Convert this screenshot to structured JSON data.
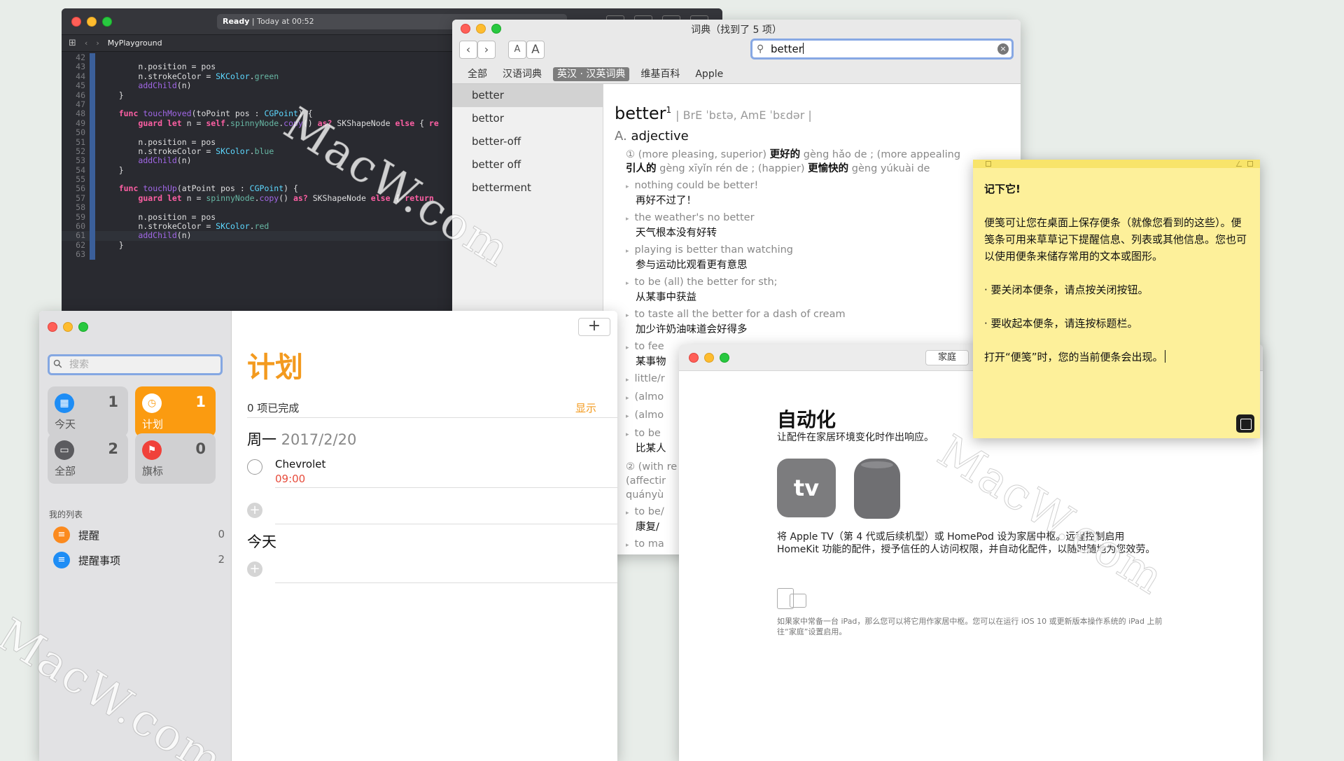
{
  "xcode": {
    "status_ready": "Ready",
    "status_time": " | Today at 00:52",
    "file": "MyPlayground",
    "lines": [
      {
        "n": "42",
        "html": ""
      },
      {
        "n": "43",
        "html": "        n.position = pos"
      },
      {
        "n": "44",
        "html": "        n.strokeColor = <span class='ty'>SKColor</span>.<span class='pr'>green</span>"
      },
      {
        "n": "45",
        "html": "        <span class='fn'>addChild</span>(n)"
      },
      {
        "n": "46",
        "html": "    }"
      },
      {
        "n": "47",
        "html": ""
      },
      {
        "n": "48",
        "html": "    <span class='kw'>func</span> <span class='fn'>touchMoved</span>(toPoint pos : <span class='ty'>CGPoint</span>) {"
      },
      {
        "n": "49",
        "html": "        <span class='kw'>guard let</span> n = <span class='kw'>self</span>.<span class='pr'>spinnyNode</span>.<span class='fn'>copy</span>() <span class='kw'>as?</span> SKShapeNode <span class='kw'>else</span> { <span class='kw'>re</span>"
      },
      {
        "n": "50",
        "html": ""
      },
      {
        "n": "51",
        "html": "        n.position = pos"
      },
      {
        "n": "52",
        "html": "        n.strokeColor = <span class='ty'>SKColor</span>.<span class='pr'>blue</span>"
      },
      {
        "n": "53",
        "html": "        <span class='fn'>addChild</span>(n)"
      },
      {
        "n": "54",
        "html": "    }"
      },
      {
        "n": "55",
        "html": ""
      },
      {
        "n": "56",
        "html": "    <span class='kw'>func</span> <span class='fn'>touchUp</span>(atPoint pos : <span class='ty'>CGPoint</span>) {"
      },
      {
        "n": "57",
        "html": "        <span class='kw'>guard let</span> n = <span class='pr'>spinnyNode</span>.<span class='fn'>copy</span>() <span class='kw'>as?</span> SKShapeNode <span class='kw'>else</span> { <span class='kw'>return</span>"
      },
      {
        "n": "58",
        "html": ""
      },
      {
        "n": "59",
        "html": "        n.position = pos"
      },
      {
        "n": "60",
        "html": "        n.strokeColor = <span class='ty'>SKColor</span>.<span class='pr'>red</span>"
      },
      {
        "n": "61",
        "html": "        <span class='fn'>addChild</span>(n)"
      },
      {
        "n": "62",
        "html": "    }"
      },
      {
        "n": "63",
        "html": ""
      }
    ]
  },
  "dict": {
    "window_title": "词典（找到了 5 项）",
    "back": "‹",
    "forward": "›",
    "font_small": "A",
    "font_big": "A",
    "search_value": "better",
    "tabs": [
      "全部",
      "汉语词典",
      "英汉 · 汉英词典",
      "维基百科",
      "Apple"
    ],
    "selected_tab": 2,
    "results": [
      "better",
      "bettor",
      "better-off",
      "better off",
      "betterment"
    ],
    "headword": "better",
    "sup": "1",
    "pron": "| BrE ˈbɛtə,  AmE ˈbɛdər |",
    "pos_letter": "A.",
    "pos": "adjective",
    "sense1_a": "① (more pleasing, superior) ",
    "sense1_b": "更好的",
    "sense1_c": " gèng hǎo de ; (more appealing",
    "sense1_d": "引人的",
    "sense1_e": " gèng xīyǐn rén de ; (happier) ",
    "sense1_f": "更愉快的",
    "sense1_g": " gèng yúkuài de",
    "examples": [
      {
        "en": "nothing could be better!",
        "zh": "再好不过了！"
      },
      {
        "en": "the weather's no better",
        "zh": "天气根本没有好转"
      },
      {
        "en": "playing is better than watching",
        "zh": "参与运动比观看更有意思"
      },
      {
        "en": "to be (all) the better for sth;",
        "zh": "从某事中获益"
      },
      {
        "en": "to taste all the better for a dash of cream",
        "zh": "加少许奶油味道会好得多"
      },
      {
        "en": "to fee",
        "zh": "某事物"
      },
      {
        "en": "little/r",
        "zh": ""
      },
      {
        "en": "(almo",
        "zh": ""
      },
      {
        "en": "(almo",
        "zh": ""
      },
      {
        "en": "to be",
        "zh": "比某人"
      }
    ],
    "sense2_a": "② (with re",
    "sense2_b": "(affectir",
    "sense2_c": "quányù",
    "examples2": [
      {
        "en": "to be/",
        "zh": "康复/"
      },
      {
        "en": "to ma",
        "zh": ""
      }
    ]
  },
  "reminders": {
    "search_placeholder": "搜索",
    "tiles": [
      {
        "label": "今天",
        "count": "1",
        "icon": "calendar-icon",
        "glyph": "▦",
        "color": "#1e8df5"
      },
      {
        "label": "计划",
        "count": "1",
        "icon": "clock-icon",
        "glyph": "◷",
        "color": "#ffffff"
      },
      {
        "label": "全部",
        "count": "2",
        "icon": "tray-icon",
        "glyph": "▭",
        "color": "#5b5b5f"
      },
      {
        "label": "旗标",
        "count": "0",
        "icon": "flag-icon",
        "glyph": "⚑",
        "color": "#f0413a"
      }
    ],
    "my_lists": "我的列表",
    "lists": [
      {
        "name": "提醒",
        "count": "0",
        "color": "#fb8a1e"
      },
      {
        "name": "提醒事项",
        "count": "2",
        "color": "#1e8df5"
      }
    ],
    "add": "+",
    "title": "计划",
    "completed": "0 项已完成",
    "show": "显示",
    "day1": "周一",
    "day1_date": " 2017/2/20",
    "task_title": "Chevrolet",
    "task_time": "09:00",
    "day2": "今天"
  },
  "home": {
    "button": "家庭",
    "title": "自动化",
    "subtitle": "让配件在家居环境变化时作出响应。",
    "atv_label": "tv",
    "desc": "将 Apple TV（第 4 代或后续机型）或 HomePod 设为家居中枢。远程控制启用 HomeKit 功能的配件，授予信任的人访问权限，并自动化配件，以随时随地为您效劳。",
    "note": "如果家中常备一台 iPad，那么您可以将它用作家居中枢。您可以在运行 iOS 10 或更新版本操作系统的 iPad 上前往“家庭”设置启用。"
  },
  "sticky": {
    "line1": "记下它!",
    "line2": "便笺可让您在桌面上保存便条（就像您看到的这些）。便笺条可用来草草记下提醒信息、列表或其他信息。您也可以使用便条来储存常用的文本或图形。",
    "line3": "· 要关闭本便条，请点按关闭按钮。",
    "line4": "· 要收起本便条，请连按标题栏。",
    "line5": "打开“便笺”时，您的当前便条会出现。"
  },
  "watermark": "MacW.com"
}
